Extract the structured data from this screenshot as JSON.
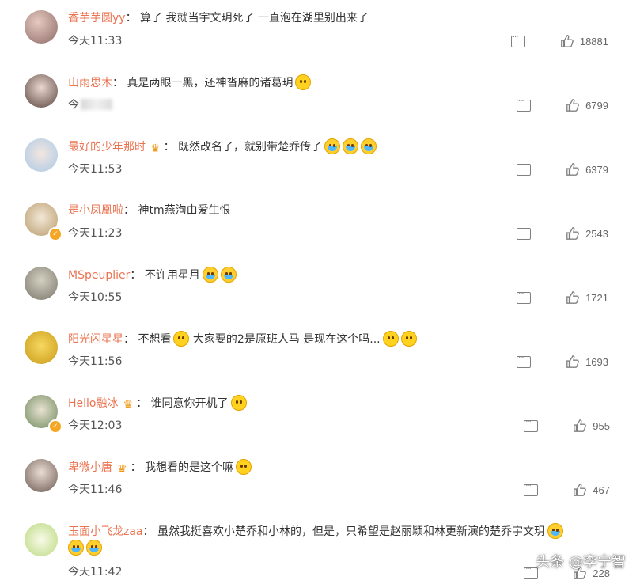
{
  "comments": [
    {
      "username": "香芋芋圆yy",
      "sep": "：",
      "text": "算了 我就当宇文玥死了 一直泡在湖里别出来了",
      "time": "今天11:33",
      "likes": "18881",
      "crown": false,
      "badge": false,
      "emojis": [],
      "avatar_color": "#b98f8a"
    },
    {
      "username": "山雨思木",
      "sep": "：",
      "text": "真是两眼一黑，还神沓麻的诸葛玥",
      "time": "今",
      "likes": "6799",
      "crown": false,
      "badge": false,
      "emojis": [
        "smile"
      ],
      "avatar_color": "#7e6a63"
    },
    {
      "username": "最好的少年那时",
      "sep": "：",
      "text": "既然改名了，就别带楚乔传了",
      "time": "今天11:53",
      "likes": "6379",
      "crown": true,
      "badge": false,
      "emojis": [
        "cry",
        "cry",
        "cry"
      ],
      "avatar_color": "#a9c9e6"
    },
    {
      "username": "是小凤凰啦",
      "sep": "：",
      "text": "神tm燕洵由爱生恨",
      "time": "今天11:23",
      "likes": "2543",
      "crown": false,
      "badge": true,
      "emojis": [],
      "avatar_color": "#d6c3a2"
    },
    {
      "username": "MSpeuplier",
      "sep": "：",
      "text": "不许用星月",
      "time": "今天10:55",
      "likes": "1721",
      "crown": false,
      "badge": false,
      "emojis": [
        "cry",
        "cry"
      ],
      "avatar_color": "#9c9a8d"
    },
    {
      "username": "阳光闪星星",
      "sep": "：",
      "text": "不想看",
      "text2": "大家要的2是原班人马 是现在这个吗...",
      "time": "今天11:56",
      "likes": "1693",
      "crown": false,
      "badge": false,
      "emojis": [
        "think"
      ],
      "emojis2": [
        "smile",
        "sweat"
      ],
      "avatar_color": "#e2c04a"
    },
    {
      "username": "Hello融冰",
      "sep": "：",
      "text": "谁同意你开机了",
      "time": "今天12:03",
      "likes": "955",
      "crown": true,
      "badge": true,
      "emojis": [
        "smile"
      ],
      "avatar_color": "#8aa87f"
    },
    {
      "username": "卑微小唐",
      "sep": "：",
      "text": "我想看的是这个嘛",
      "time": "今天11:46",
      "likes": "467",
      "crown": true,
      "badge": false,
      "emojis": [
        "doge"
      ],
      "avatar_color": "#8a7d75"
    },
    {
      "username": "玉面小飞龙zaa",
      "sep": "：",
      "text": "虽然我挺喜欢小楚乔和小林的，但是，只希望是赵丽颖和林更新演的楚乔宇文玥",
      "time": "今天11:42",
      "likes": "228",
      "crown": false,
      "badge": false,
      "emojis": [
        "cry"
      ],
      "emojis_line2": [
        "cry",
        "cry"
      ],
      "avatar_color": "#cde3a9"
    }
  ],
  "watermark": "头条 @李宁智",
  "colors": {
    "username": "#eb7350",
    "text": "#333333",
    "accent_badge": "#f5a623"
  },
  "icons": {
    "comment": "comment-icon",
    "like": "thumbs-up-icon"
  }
}
